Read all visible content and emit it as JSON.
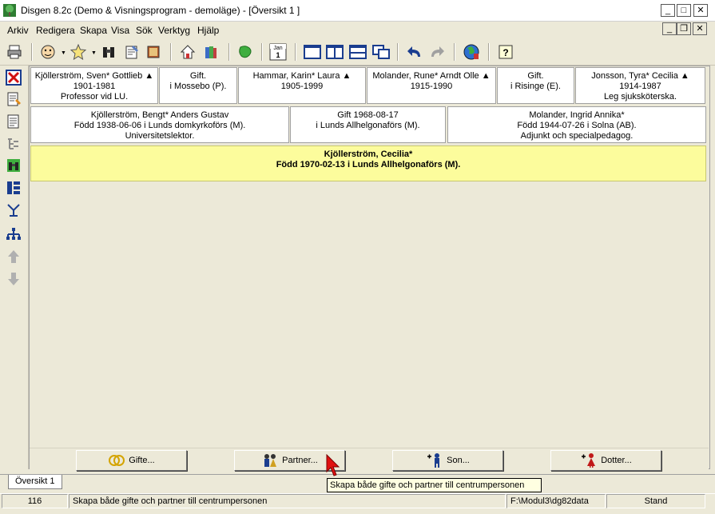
{
  "window": {
    "title": "Disgen 8.2c (Demo & Visningsprogram - demoläge) - [Översikt 1 ]",
    "app_icon": "tree-icon",
    "minimize": "_",
    "maximize": "□",
    "close": "✕"
  },
  "menu": {
    "items": [
      "Arkiv",
      "Redigera",
      "Skapa",
      "Visa",
      "Sök",
      "Verktyg",
      "Hjälp"
    ]
  },
  "toolbar": {
    "icons": [
      "printer-icon",
      "person-icon",
      "star-person-icon",
      "binoculars-icon",
      "notepad-icon",
      "book-icon",
      "house-icon",
      "books-icon",
      "map-icon",
      "calendar-icon",
      "layout-one-icon",
      "layout-two-icon",
      "layout-rows-icon",
      "layout-overlap-icon",
      "undo-icon",
      "redo-icon",
      "globe-icon",
      "help-icon"
    ],
    "calendar_label": "Jan",
    "calendar_day": "1",
    "help_label": "?"
  },
  "left_toolbar": {
    "icons": [
      "close-red-icon",
      "edit-note-icon",
      "document-icon",
      "tree-structure-icon",
      "binoculars-icon",
      "ancestor-chart-icon",
      "descendant-tree-icon",
      "org-chart-icon",
      "go-up-icon",
      "go-down-icon"
    ]
  },
  "grandparents": [
    {
      "line1": "Kjöllerström, Sven* Gottlieb ▲",
      "line2": "1901-1981",
      "line3": "Professor vid LU."
    },
    {
      "line1": "Gift.",
      "line2": "i Mossebo (P).",
      "line3": ""
    },
    {
      "line1": "Hammar, Karin* Laura ▲",
      "line2": "1905-1999",
      "line3": ""
    },
    {
      "line1": "Molander, Rune* Arndt Olle ▲",
      "line2": "1915-1990",
      "line3": ""
    },
    {
      "line1": "Gift.",
      "line2": "i Risinge (E).",
      "line3": ""
    },
    {
      "line1": "Jonsson, Tyra* Cecilia ▲",
      "line2": "1914-1987",
      "line3": "Leg sjuksköterska."
    }
  ],
  "parents": [
    {
      "line1": "Kjöllerström, Bengt* Anders Gustav",
      "line2": "Född 1938-06-06 i Lunds domkyrkoförs (M).",
      "line3": "Universitetslektor."
    },
    {
      "line1": "Gift 1968-08-17",
      "line2": "i Lunds Allhelgonaförs (M).",
      "line3": ""
    },
    {
      "line1": "Molander, Ingrid Annika*",
      "line2": "Född 1944-07-26 i Solna (AB).",
      "line3": "Adjunkt och specialpedagog."
    }
  ],
  "center_person": {
    "name": "Kjöllerström, Cecilia*",
    "born": "Född 1970-02-13 i Lunds Allhelgonaförs (M)."
  },
  "actions": {
    "gifte": "Gifte...",
    "partner": "Partner...",
    "son": "Son...",
    "dotter": "Dotter..."
  },
  "tab": {
    "label": "Översikt 1"
  },
  "tooltip": "Skapa både gifte och partner till centrumpersonen",
  "status": {
    "number": "116",
    "message": "Skapa både gifte och partner till centrumpersonen",
    "path": "F:\\Modul3\\dg82data",
    "mode": "Stand"
  },
  "colors": {
    "center_highlight": "#fcfc9c",
    "window_bg": "#ece9d8",
    "tooltip_bg": "#ffffe1"
  }
}
